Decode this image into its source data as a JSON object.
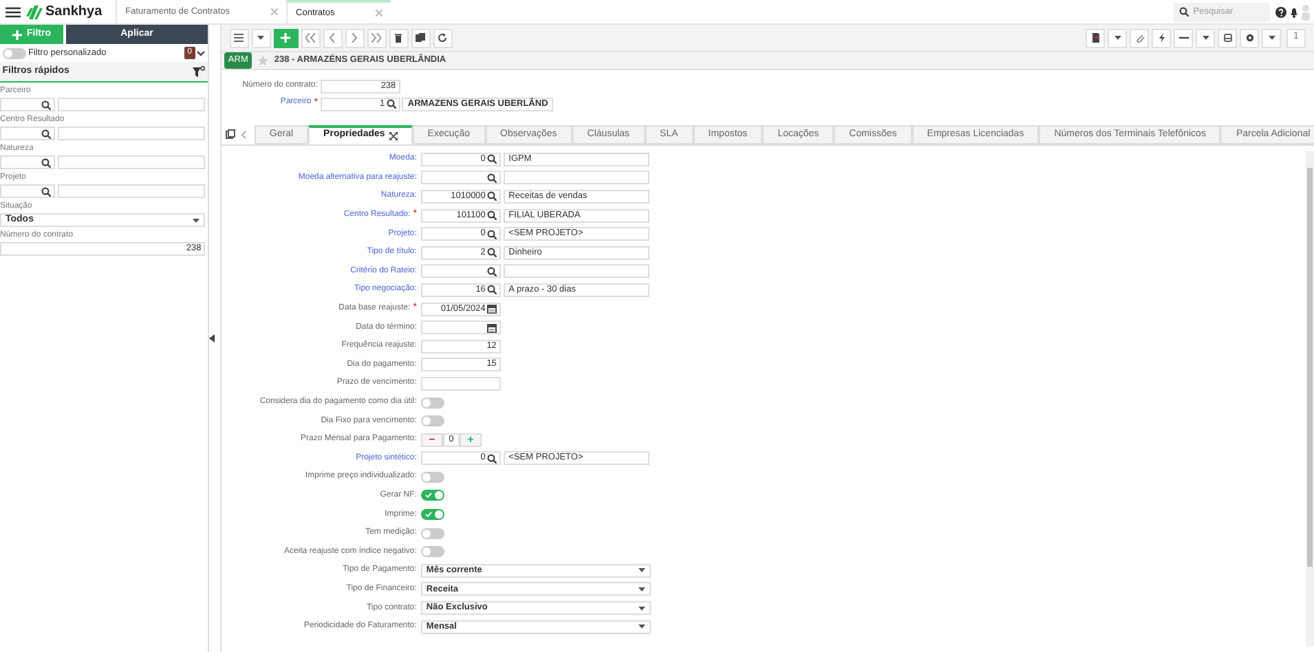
{
  "app_header": {
    "logo": "Sankhya",
    "tabs": [
      {
        "label": "Faturamento de Contratos",
        "selected": false
      },
      {
        "label": "Contratos",
        "selected": true
      }
    ],
    "search": {
      "placeholder": "Pesquisar"
    }
  },
  "sidebar": {
    "filter_button": "Filtro",
    "apply_button": "Aplicar",
    "custom_filter": {
      "label": "Filtro personalizado",
      "on": false,
      "count": "0"
    },
    "quick_filters_title": "Filtros rápidos",
    "fields": [
      {
        "kind": "lookup",
        "label": "Parceiro"
      },
      {
        "kind": "lookup",
        "label": "Centro Resultado"
      },
      {
        "kind": "lookup",
        "label": "Natureza"
      },
      {
        "kind": "lookup",
        "label": "Projeto"
      },
      {
        "kind": "select",
        "label": "Situação",
        "value": "Todos"
      },
      {
        "kind": "text",
        "label": "Número do contrato",
        "value": "238"
      }
    ]
  },
  "toolbar": {
    "page_number": "1"
  },
  "record": {
    "badge": "ARM",
    "title": "238 - ARMAZÉNS GERAIS UBERLÂNDIA",
    "favorite": false
  },
  "header_fields": {
    "contract_label": "Número do contrato:",
    "contract_number": "238",
    "partner_label": "Parceiro",
    "partner_required_mark": "*",
    "partner_code": "1",
    "partner_name": "ARMAZENS GERAIS UBERLÂND"
  },
  "form_tabs": [
    {
      "label": "Geral",
      "selected": false
    },
    {
      "label": "Propriedades",
      "selected": true
    },
    {
      "label": "Execução",
      "selected": false
    },
    {
      "label": "Observações",
      "selected": false
    },
    {
      "label": "Cláusulas",
      "selected": false
    },
    {
      "label": "SLA",
      "selected": false
    },
    {
      "label": "Impostos",
      "selected": false
    },
    {
      "label": "Locações",
      "selected": false
    },
    {
      "label": "Comissões",
      "selected": false
    },
    {
      "label": "Empresas Licenciadas",
      "selected": false
    },
    {
      "label": "Números dos Terminais Telefônicos",
      "selected": false
    },
    {
      "label": "Parcela Adicional",
      "selected": false
    }
  ],
  "form_rows": [
    {
      "kind": "lookup",
      "label": "Moeda:",
      "link": true,
      "code": "0",
      "description": "IGPM"
    },
    {
      "kind": "lookup",
      "label": "Moeda alternativa para reajuste:",
      "link": true
    },
    {
      "kind": "lookup",
      "label": "Natureza:",
      "link": true,
      "code": "1010000",
      "description": "Receitas de vendas"
    },
    {
      "kind": "lookup",
      "label": "Centro Resultado:",
      "link": true,
      "required_mark": "*",
      "code": "101100",
      "description": "FILIAL UBERADA"
    },
    {
      "kind": "lookup",
      "label": "Projeto:",
      "link": true,
      "code": "0",
      "description": "<SEM PROJETO>"
    },
    {
      "kind": "lookup",
      "label": "Tipo de título:",
      "link": true,
      "code": "2",
      "description": "Dinheiro"
    },
    {
      "kind": "lookup",
      "label": "Critério do Rateio:",
      "link": true
    },
    {
      "kind": "lookup",
      "label": "Tipo negociação:",
      "link": true,
      "code": "16",
      "description": "A prazo - 30 dias"
    },
    {
      "kind": "date",
      "label": "Data base reajuste:",
      "required_mark": "*",
      "value": "01/05/2024"
    },
    {
      "kind": "date",
      "label": "Data do término:"
    },
    {
      "kind": "number",
      "label": "Frequência reajuste:",
      "value": "12"
    },
    {
      "kind": "number",
      "label": "Dia do pagamento:",
      "value": "15"
    },
    {
      "kind": "number",
      "label": "Prazo de vencimento:"
    },
    {
      "kind": "toggle",
      "label": "Considera dia do pagamento como dia útil:",
      "on": false
    },
    {
      "kind": "toggle",
      "label": "Dia Fixo para vencimento:",
      "on": false
    },
    {
      "kind": "stepper",
      "label": "Prazo Mensal para Pagamento:",
      "minus": "−",
      "value": "0",
      "plus": "+"
    },
    {
      "kind": "lookup",
      "label": "Projeto sintético:",
      "link": true,
      "code": "0",
      "description": "<SEM PROJETO>"
    },
    {
      "kind": "toggle",
      "label": "Imprime preço individualizado:",
      "on": false
    },
    {
      "kind": "toggle",
      "label": "Gerar NF:",
      "on": true
    },
    {
      "kind": "toggle",
      "label": "Imprime:",
      "on": true
    },
    {
      "kind": "toggle",
      "label": "Tem medição:",
      "on": false
    },
    {
      "kind": "toggle",
      "label": "Aceita reajuste com índice negativo:",
      "on": false
    },
    {
      "kind": "select",
      "label": "Tipo de Pagamento:",
      "value": "Mês corrente"
    },
    {
      "kind": "select",
      "label": "Tipo de Financeiro:",
      "value": "Receita"
    },
    {
      "kind": "select",
      "label": "Tipo contrato:",
      "value": "Não Exclusivo"
    },
    {
      "kind": "select",
      "label": "Periodicidade do Faturamento:",
      "value": "Mensal"
    }
  ]
}
